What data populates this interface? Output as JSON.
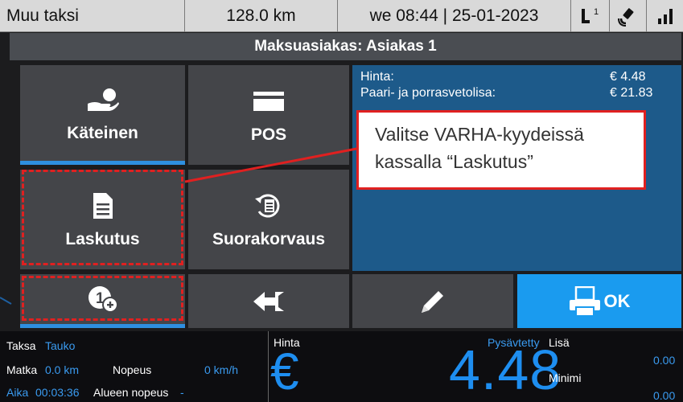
{
  "status_bar": {
    "operator": "Muu taksi",
    "distance": "128.0 km",
    "datetime": "we 08:44 | 25-01-2023",
    "nav_superscript": "1",
    "icons": [
      "navigation-icon",
      "gps-satellite-icon",
      "signal-icon"
    ]
  },
  "subtitle": "Maksuasiakas: Asiakas 1",
  "tiles": {
    "cash": "Käteinen",
    "pos": "POS",
    "invoice": "Laskutus",
    "direct": "Suorakorvaus",
    "ok": "OK"
  },
  "prices": [
    {
      "label": "Hinta:",
      "value": "€ 4.48"
    },
    {
      "label": "Paari- ja porrasvetolisa:",
      "value": "€ 21.83"
    }
  ],
  "callout": {
    "line1": "Valitse VARHA-kyydeissä",
    "line2": "kassalla “Laskutus”"
  },
  "meter": {
    "tariff_label": "Taksa",
    "tariff_value": "Tauko",
    "trip_label": "Matka",
    "trip_value": "0.0 km",
    "speed_label": "Nopeus",
    "speed_value": "0 km/h",
    "time_label": "Aika",
    "time_value": "00:03:36",
    "area_speed_label": "Alueen nopeus",
    "area_speed_value": "-",
    "price_label": "Hinta",
    "currency": "€",
    "price_value": "4.48",
    "fixed_label": "Pysävtetty",
    "extra_label": "Lisä",
    "extra_value": "0.00",
    "minimum_label": "Minimi",
    "minimum_value": "0.00"
  },
  "colors": {
    "accent_blue": "#1a9bef",
    "panel_blue": "#1d5a8a",
    "annotation_red": "#e02020"
  }
}
